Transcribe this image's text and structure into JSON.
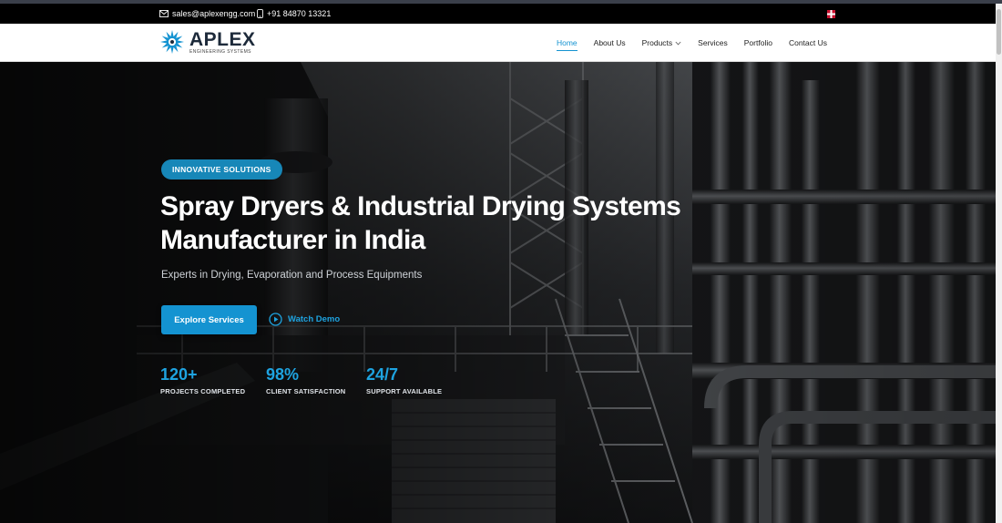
{
  "contact": {
    "email": "sales@aplexengg.com",
    "phone": "+91 84870 13321"
  },
  "brand": {
    "name": "APLEX",
    "tagline": "ENGINEERING SYSTEMS"
  },
  "nav": {
    "items": [
      {
        "label": "Home",
        "active": true
      },
      {
        "label": "About Us"
      },
      {
        "label": "Products",
        "has_dropdown": true
      },
      {
        "label": "Services"
      },
      {
        "label": "Portfolio"
      },
      {
        "label": "Contact Us"
      }
    ]
  },
  "hero": {
    "badge": "INNOVATIVE SOLUTIONS",
    "title_line1": "Spray Dryers & Industrial Drying Systems",
    "title_line2": "Manufacturer in India",
    "subtitle": "Experts in Drying, Evaporation and Process Equipments",
    "primary_cta": "Explore Services",
    "secondary_cta": "Watch Demo"
  },
  "stats": [
    {
      "value": "120+",
      "label": "PROJECTS COMPLETED"
    },
    {
      "value": "98%",
      "label": "CLIENT SATISFACTION"
    },
    {
      "value": "24/7",
      "label": "SUPPORT AVAILABLE"
    }
  ],
  "colors": {
    "accent": "#1493d1",
    "badge": "#1787b8",
    "stat_value": "#1ea3e0",
    "brand_dark": "#1d2a3a"
  },
  "icons": [
    "mail-icon",
    "phone-icon",
    "flag-icon",
    "logo-starburst-icon",
    "chevron-down-icon",
    "play-circle-icon"
  ]
}
